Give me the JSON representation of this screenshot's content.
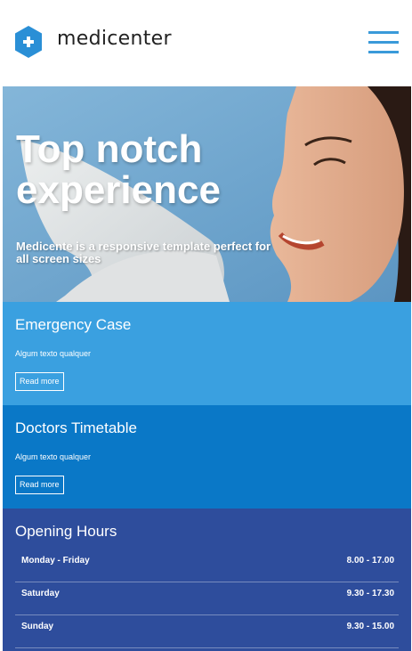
{
  "header": {
    "brand": "medicenter",
    "logo_icon": "plus-hexagon-icon",
    "menu_icon": "hamburger-menu-icon",
    "accent_color": "#3a9ad9"
  },
  "hero": {
    "title": "Top notch experience",
    "subtitle": "Medicente is a responsive template perfect for all screen sizes"
  },
  "panels": [
    {
      "title": "Emergency Case",
      "text": "Algum texto qualquer",
      "button": "Read more",
      "color": "#3aa0e0"
    },
    {
      "title": "Doctors Timetable",
      "text": "Algum texto qualquer",
      "button": "Read more",
      "color": "#0a78c7"
    }
  ],
  "opening_hours": {
    "title": "Opening Hours",
    "color": "#2e4d9c",
    "rows": [
      {
        "day": "Monday - Friday",
        "time": "8.00 - 17.00"
      },
      {
        "day": "Saturday",
        "time": "9.30 - 17.30"
      },
      {
        "day": "Sunday",
        "time": "9.30 - 15.00"
      }
    ]
  }
}
